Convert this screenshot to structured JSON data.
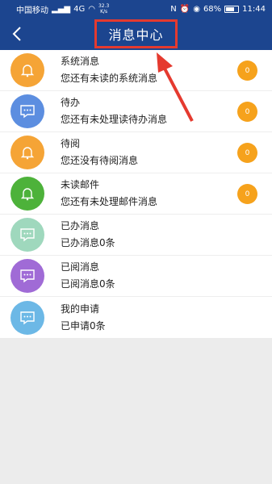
{
  "status_bar": {
    "carrier": "中国移动",
    "network": "4G",
    "speed_value": "32.3",
    "speed_unit": "K/s",
    "battery_text": "68%",
    "battery_level": 0.68,
    "time": "11:44"
  },
  "header": {
    "title": "消息中心"
  },
  "colors": {
    "header_bg": "#1c458f",
    "highlight": "#e53a2f",
    "badge": "#f6a21c"
  },
  "items": [
    {
      "title": "系统消息",
      "subtitle": "您还有未读的系统消息",
      "badge": "0",
      "icon": "bell-icon",
      "color": "#f5a436"
    },
    {
      "title": "待办",
      "subtitle": "您还有未处理读待办消息",
      "badge": "0",
      "icon": "chat-icon",
      "color": "#5c8ee0"
    },
    {
      "title": "待阅",
      "subtitle": "您还没有待阅消息",
      "badge": "0",
      "icon": "bell-icon",
      "color": "#f5a436"
    },
    {
      "title": "未读邮件",
      "subtitle": "您还有未处理邮件消息",
      "badge": "0",
      "icon": "bell-icon",
      "color": "#4db23a"
    },
    {
      "title": "已办消息",
      "subtitle": "已办消息0条",
      "icon": "chat-icon",
      "color": "#9fd8bd"
    },
    {
      "title": "已阅消息",
      "subtitle": "已阅消息0条",
      "icon": "chat-icon",
      "color": "#a06bd6"
    },
    {
      "title": "我的申请",
      "subtitle": "已申请0条",
      "icon": "chat-icon",
      "color": "#6cb8e6"
    }
  ]
}
